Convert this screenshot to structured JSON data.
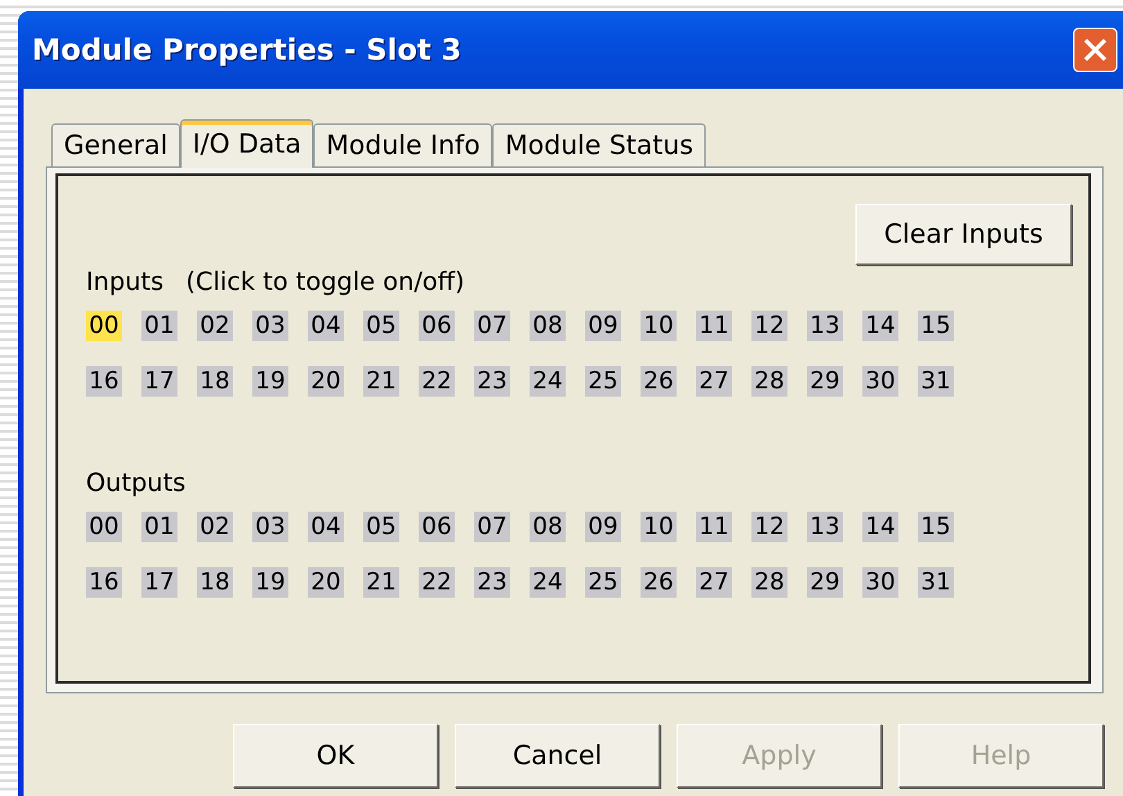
{
  "window": {
    "title": "Module Properties - Slot 3"
  },
  "tabs": [
    {
      "label": "General",
      "selected": false
    },
    {
      "label": "I/O Data",
      "selected": true
    },
    {
      "label": "Module Info",
      "selected": false
    },
    {
      "label": "Module Status",
      "selected": false
    }
  ],
  "clear_button": {
    "label": "Clear Inputs"
  },
  "inputs": {
    "label": "Inputs",
    "hint": "(Click to toggle on/off)",
    "bits": [
      {
        "label": "00",
        "on": true
      },
      {
        "label": "01",
        "on": false
      },
      {
        "label": "02",
        "on": false
      },
      {
        "label": "03",
        "on": false
      },
      {
        "label": "04",
        "on": false
      },
      {
        "label": "05",
        "on": false
      },
      {
        "label": "06",
        "on": false
      },
      {
        "label": "07",
        "on": false
      },
      {
        "label": "08",
        "on": false
      },
      {
        "label": "09",
        "on": false
      },
      {
        "label": "10",
        "on": false
      },
      {
        "label": "11",
        "on": false
      },
      {
        "label": "12",
        "on": false
      },
      {
        "label": "13",
        "on": false
      },
      {
        "label": "14",
        "on": false
      },
      {
        "label": "15",
        "on": false
      },
      {
        "label": "16",
        "on": false
      },
      {
        "label": "17",
        "on": false
      },
      {
        "label": "18",
        "on": false
      },
      {
        "label": "19",
        "on": false
      },
      {
        "label": "20",
        "on": false
      },
      {
        "label": "21",
        "on": false
      },
      {
        "label": "22",
        "on": false
      },
      {
        "label": "23",
        "on": false
      },
      {
        "label": "24",
        "on": false
      },
      {
        "label": "25",
        "on": false
      },
      {
        "label": "26",
        "on": false
      },
      {
        "label": "27",
        "on": false
      },
      {
        "label": "28",
        "on": false
      },
      {
        "label": "29",
        "on": false
      },
      {
        "label": "30",
        "on": false
      },
      {
        "label": "31",
        "on": false
      }
    ]
  },
  "outputs": {
    "label": "Outputs",
    "bits": [
      {
        "label": "00",
        "on": false
      },
      {
        "label": "01",
        "on": false
      },
      {
        "label": "02",
        "on": false
      },
      {
        "label": "03",
        "on": false
      },
      {
        "label": "04",
        "on": false
      },
      {
        "label": "05",
        "on": false
      },
      {
        "label": "06",
        "on": false
      },
      {
        "label": "07",
        "on": false
      },
      {
        "label": "08",
        "on": false
      },
      {
        "label": "09",
        "on": false
      },
      {
        "label": "10",
        "on": false
      },
      {
        "label": "11",
        "on": false
      },
      {
        "label": "12",
        "on": false
      },
      {
        "label": "13",
        "on": false
      },
      {
        "label": "14",
        "on": false
      },
      {
        "label": "15",
        "on": false
      },
      {
        "label": "16",
        "on": false
      },
      {
        "label": "17",
        "on": false
      },
      {
        "label": "18",
        "on": false
      },
      {
        "label": "19",
        "on": false
      },
      {
        "label": "20",
        "on": false
      },
      {
        "label": "21",
        "on": false
      },
      {
        "label": "22",
        "on": false
      },
      {
        "label": "23",
        "on": false
      },
      {
        "label": "24",
        "on": false
      },
      {
        "label": "25",
        "on": false
      },
      {
        "label": "26",
        "on": false
      },
      {
        "label": "27",
        "on": false
      },
      {
        "label": "28",
        "on": false
      },
      {
        "label": "29",
        "on": false
      },
      {
        "label": "30",
        "on": false
      },
      {
        "label": "31",
        "on": false
      }
    ]
  },
  "buttons": [
    {
      "label": "OK",
      "disabled": false
    },
    {
      "label": "Cancel",
      "disabled": false
    },
    {
      "label": "Apply",
      "disabled": true
    },
    {
      "label": "Help",
      "disabled": true
    }
  ]
}
